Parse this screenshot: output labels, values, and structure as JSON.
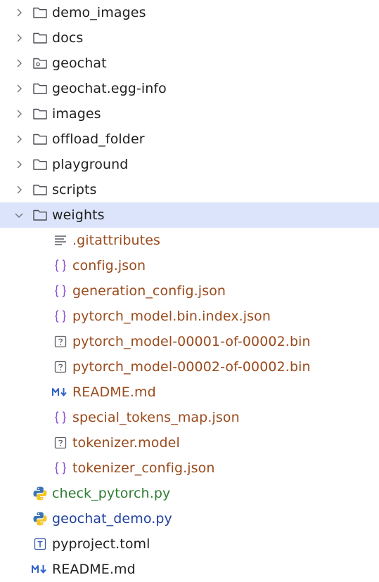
{
  "tree": {
    "items": [
      {
        "label": "demo_images",
        "kind": "folder",
        "icon": "folder-icon",
        "expanded": false
      },
      {
        "label": "docs",
        "kind": "folder",
        "icon": "folder-icon",
        "expanded": false
      },
      {
        "label": "geochat",
        "kind": "folder",
        "icon": "package-folder-icon",
        "expanded": false
      },
      {
        "label": "geochat.egg-info",
        "kind": "folder",
        "icon": "folder-icon",
        "expanded": false
      },
      {
        "label": "images",
        "kind": "folder",
        "icon": "folder-icon",
        "expanded": false
      },
      {
        "label": "offload_folder",
        "kind": "folder",
        "icon": "folder-icon",
        "expanded": false
      },
      {
        "label": "playground",
        "kind": "folder",
        "icon": "folder-icon",
        "expanded": false
      },
      {
        "label": "scripts",
        "kind": "folder",
        "icon": "folder-icon",
        "expanded": false
      },
      {
        "label": "weights",
        "kind": "folder",
        "icon": "folder-icon",
        "expanded": true,
        "selected": true
      },
      {
        "label": ".gitattributes",
        "kind": "file",
        "icon": "text-file-icon"
      },
      {
        "label": "config.json",
        "kind": "file",
        "icon": "json-icon"
      },
      {
        "label": "generation_config.json",
        "kind": "file",
        "icon": "json-icon"
      },
      {
        "label": "pytorch_model.bin.index.json",
        "kind": "file",
        "icon": "json-icon"
      },
      {
        "label": "pytorch_model-00001-of-00002.bin",
        "kind": "file",
        "icon": "unknown-file-icon"
      },
      {
        "label": "pytorch_model-00002-of-00002.bin",
        "kind": "file",
        "icon": "unknown-file-icon"
      },
      {
        "label": "README.md",
        "kind": "file",
        "icon": "markdown-icon"
      },
      {
        "label": "special_tokens_map.json",
        "kind": "file",
        "icon": "json-icon"
      },
      {
        "label": "tokenizer.model",
        "kind": "file",
        "icon": "unknown-file-icon"
      },
      {
        "label": "tokenizer_config.json",
        "kind": "file",
        "icon": "json-icon"
      },
      {
        "label": "check_pytorch.py",
        "kind": "file",
        "icon": "python-icon"
      },
      {
        "label": "geochat_demo.py",
        "kind": "file",
        "icon": "python-icon"
      },
      {
        "label": "pyproject.toml",
        "kind": "file",
        "icon": "toml-icon"
      },
      {
        "label": "README.md",
        "kind": "file",
        "icon": "markdown-icon"
      }
    ]
  },
  "colors": {
    "selection": "#dbe4fb",
    "text_default": "#1f1f1f",
    "text_ignored": "#9a4a1c",
    "text_new": "#2f7d32",
    "text_modified": "#1f3f9c",
    "json_icon": "#8a4fd6",
    "markdown_icon": "#2f62c8"
  }
}
